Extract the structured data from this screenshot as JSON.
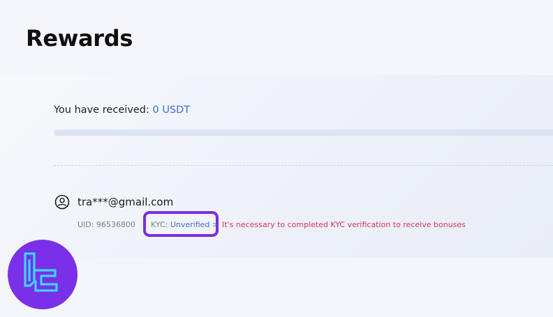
{
  "page": {
    "title": "Rewards"
  },
  "rewards": {
    "received_label": "You have received:",
    "received_amount": "0 USDT",
    "progress_fraction": 0
  },
  "account": {
    "email": "tra***@gmail.com",
    "uid_text": "UID: 96536800",
    "kyc_label": "KYC:",
    "kyc_status": "Unverified >",
    "kyc_warning": "It's necessary to completed KYC verification to receive bonuses",
    "avatar_icon": "user-circle-icon"
  },
  "watermark": {
    "icon": "tc-logo-icon",
    "background_color": "#7a2fe8",
    "stroke_color": "#38d8ff"
  },
  "colors": {
    "accent": "#3b6fd1",
    "warning": "#d9365a",
    "highlight": "#7b2fe0"
  }
}
